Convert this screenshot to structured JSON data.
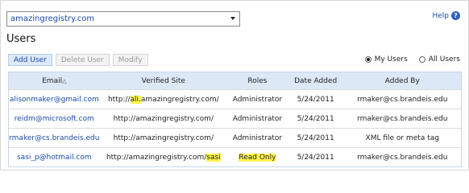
{
  "site_selector": {
    "value": "amazingregistry.com"
  },
  "help": {
    "label": "Help",
    "icon": "?"
  },
  "page_title": "Users",
  "toolbar": {
    "add_user": "Add User",
    "delete_user": "Delete User",
    "modify": "Modify"
  },
  "filters": {
    "my_users": "My Users",
    "all_users": "All Users",
    "selected": "My Users"
  },
  "table": {
    "columns": [
      "Email",
      "Verified Site",
      "Roles",
      "Date Added",
      "Added By"
    ],
    "sort_indicator": "△",
    "rows": [
      {
        "email": "alisonmaker@gmail.com",
        "site_pre": "http://",
        "site_hl": "ali.",
        "site_post": "amazingregistry.com/",
        "role": "Administrator",
        "role_hl": false,
        "date": "5/24/2011",
        "added_by": "rmaker@cs.brandeis.edu"
      },
      {
        "email": "reidm@microsoft.com",
        "site_pre": "http://amazingregistry.com/",
        "site_hl": "",
        "site_post": "",
        "role": "Administrator",
        "role_hl": false,
        "date": "5/24/2011",
        "added_by": "rmaker@cs.brandeis.edu"
      },
      {
        "email": "rmaker@cs.brandeis.edu",
        "site_pre": "http://amazingregistry.com/",
        "site_hl": "",
        "site_post": "",
        "role": "Administrator",
        "role_hl": false,
        "date": "5/24/2011",
        "added_by": "XML file or meta tag"
      },
      {
        "email": "sasi_p@hotmail.com",
        "site_pre": "http://amazingregistry.com/",
        "site_hl": "sasi",
        "site_post": "",
        "role": "Read Only",
        "role_hl": true,
        "date": "5/24/2011",
        "added_by": "rmaker@cs.brandeis.edu"
      }
    ]
  },
  "colors": {
    "link": "#1a4aa8",
    "header_bg": "#dde8f6",
    "highlight": "#fff44f"
  }
}
